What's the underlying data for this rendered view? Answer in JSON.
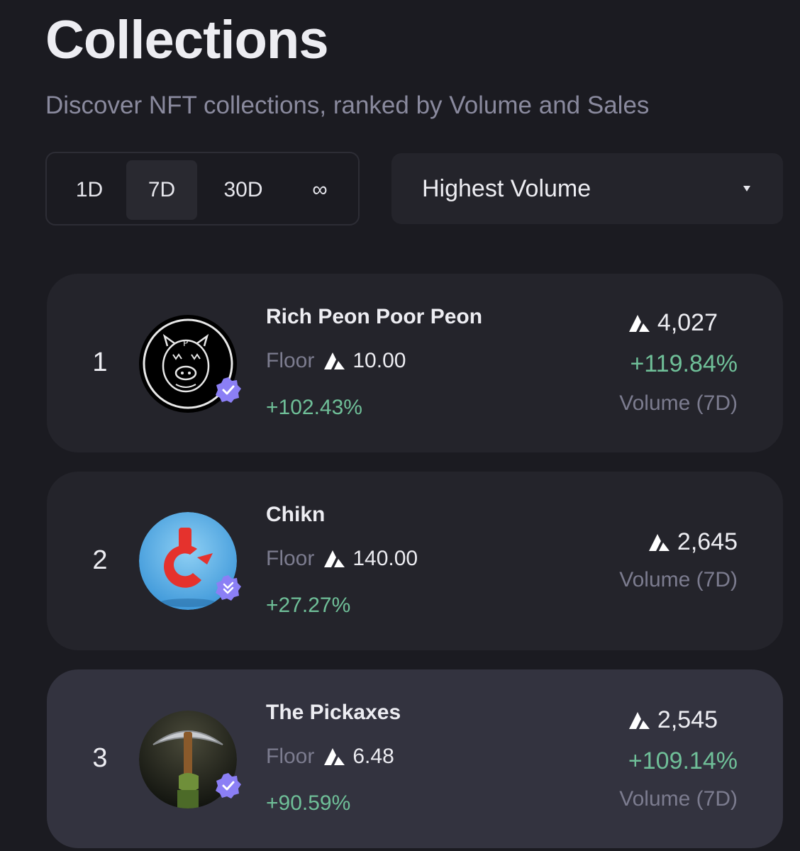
{
  "header": {
    "title": "Collections",
    "subtitle": "Discover NFT collections, ranked by Volume and Sales"
  },
  "time_range": {
    "options": [
      "1D",
      "7D",
      "30D",
      "∞"
    ],
    "selected": "7D"
  },
  "sort": {
    "selected": "Highest Volume"
  },
  "collections": [
    {
      "rank": "1",
      "name": "Rich Peon Poor Peon",
      "floor_label": "Floor",
      "floor_value": "10.00",
      "floor_change": "+102.43%",
      "volume": "4,027",
      "volume_change": "+119.84%",
      "volume_label": "Volume (7D)",
      "verified": true,
      "avatar_icon": "pig-logo-icon"
    },
    {
      "rank": "2",
      "name": "Chikn",
      "floor_label": "Floor",
      "floor_value": "140.00",
      "floor_change": "+27.27%",
      "volume": "2,645",
      "volume_change": "",
      "volume_label": "Volume (7D)",
      "verified": true,
      "avatar_icon": "chikn-logo-icon"
    },
    {
      "rank": "3",
      "name": "The Pickaxes",
      "floor_label": "Floor",
      "floor_value": "6.48",
      "floor_change": "+90.59%",
      "volume": "2,545",
      "volume_change": "+109.14%",
      "volume_label": "Volume (7D)",
      "verified": true,
      "avatar_icon": "pickaxe-logo-icon"
    }
  ],
  "colors": {
    "background": "#1b1b21",
    "card": "#24242b",
    "card_highlight": "#33333f",
    "positive": "#6fbf98",
    "muted": "#7c7c8f",
    "verified_badge": "#8b7ff5"
  }
}
